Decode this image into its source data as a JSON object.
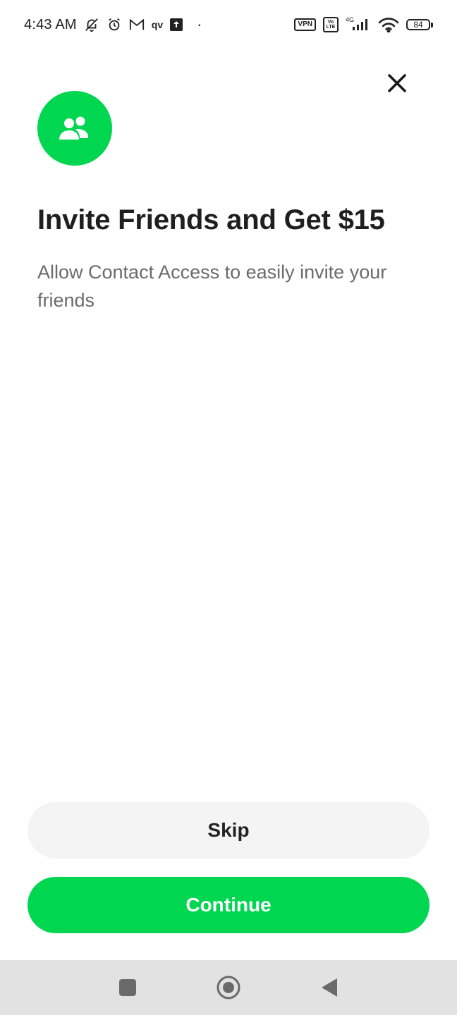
{
  "status_bar": {
    "time": "4:43 AM",
    "left_icons": [
      "bell-off-icon",
      "alarm-icon",
      "gmail-icon",
      "qv-icon",
      "upload-icon"
    ],
    "qv_label": "qv",
    "vpn_label": "VPN",
    "volte_label": "Vo LTE",
    "network_label": "4G",
    "battery_level": "84"
  },
  "header": {
    "close_icon": "close-icon"
  },
  "badge": {
    "icon": "people-icon",
    "color": "#00d64f"
  },
  "content": {
    "title": "Invite Friends and Get $15",
    "subtitle": "Allow Contact Access to easily invite your friends"
  },
  "actions": {
    "skip_label": "Skip",
    "continue_label": "Continue"
  },
  "colors": {
    "accent": "#00d64f",
    "secondary_button": "#f4f4f4",
    "nav_bar": "#e2e2e2"
  },
  "nav": {
    "recent_icon": "square-icon",
    "home_icon": "circle-home-icon",
    "back_icon": "back-triangle-icon"
  }
}
